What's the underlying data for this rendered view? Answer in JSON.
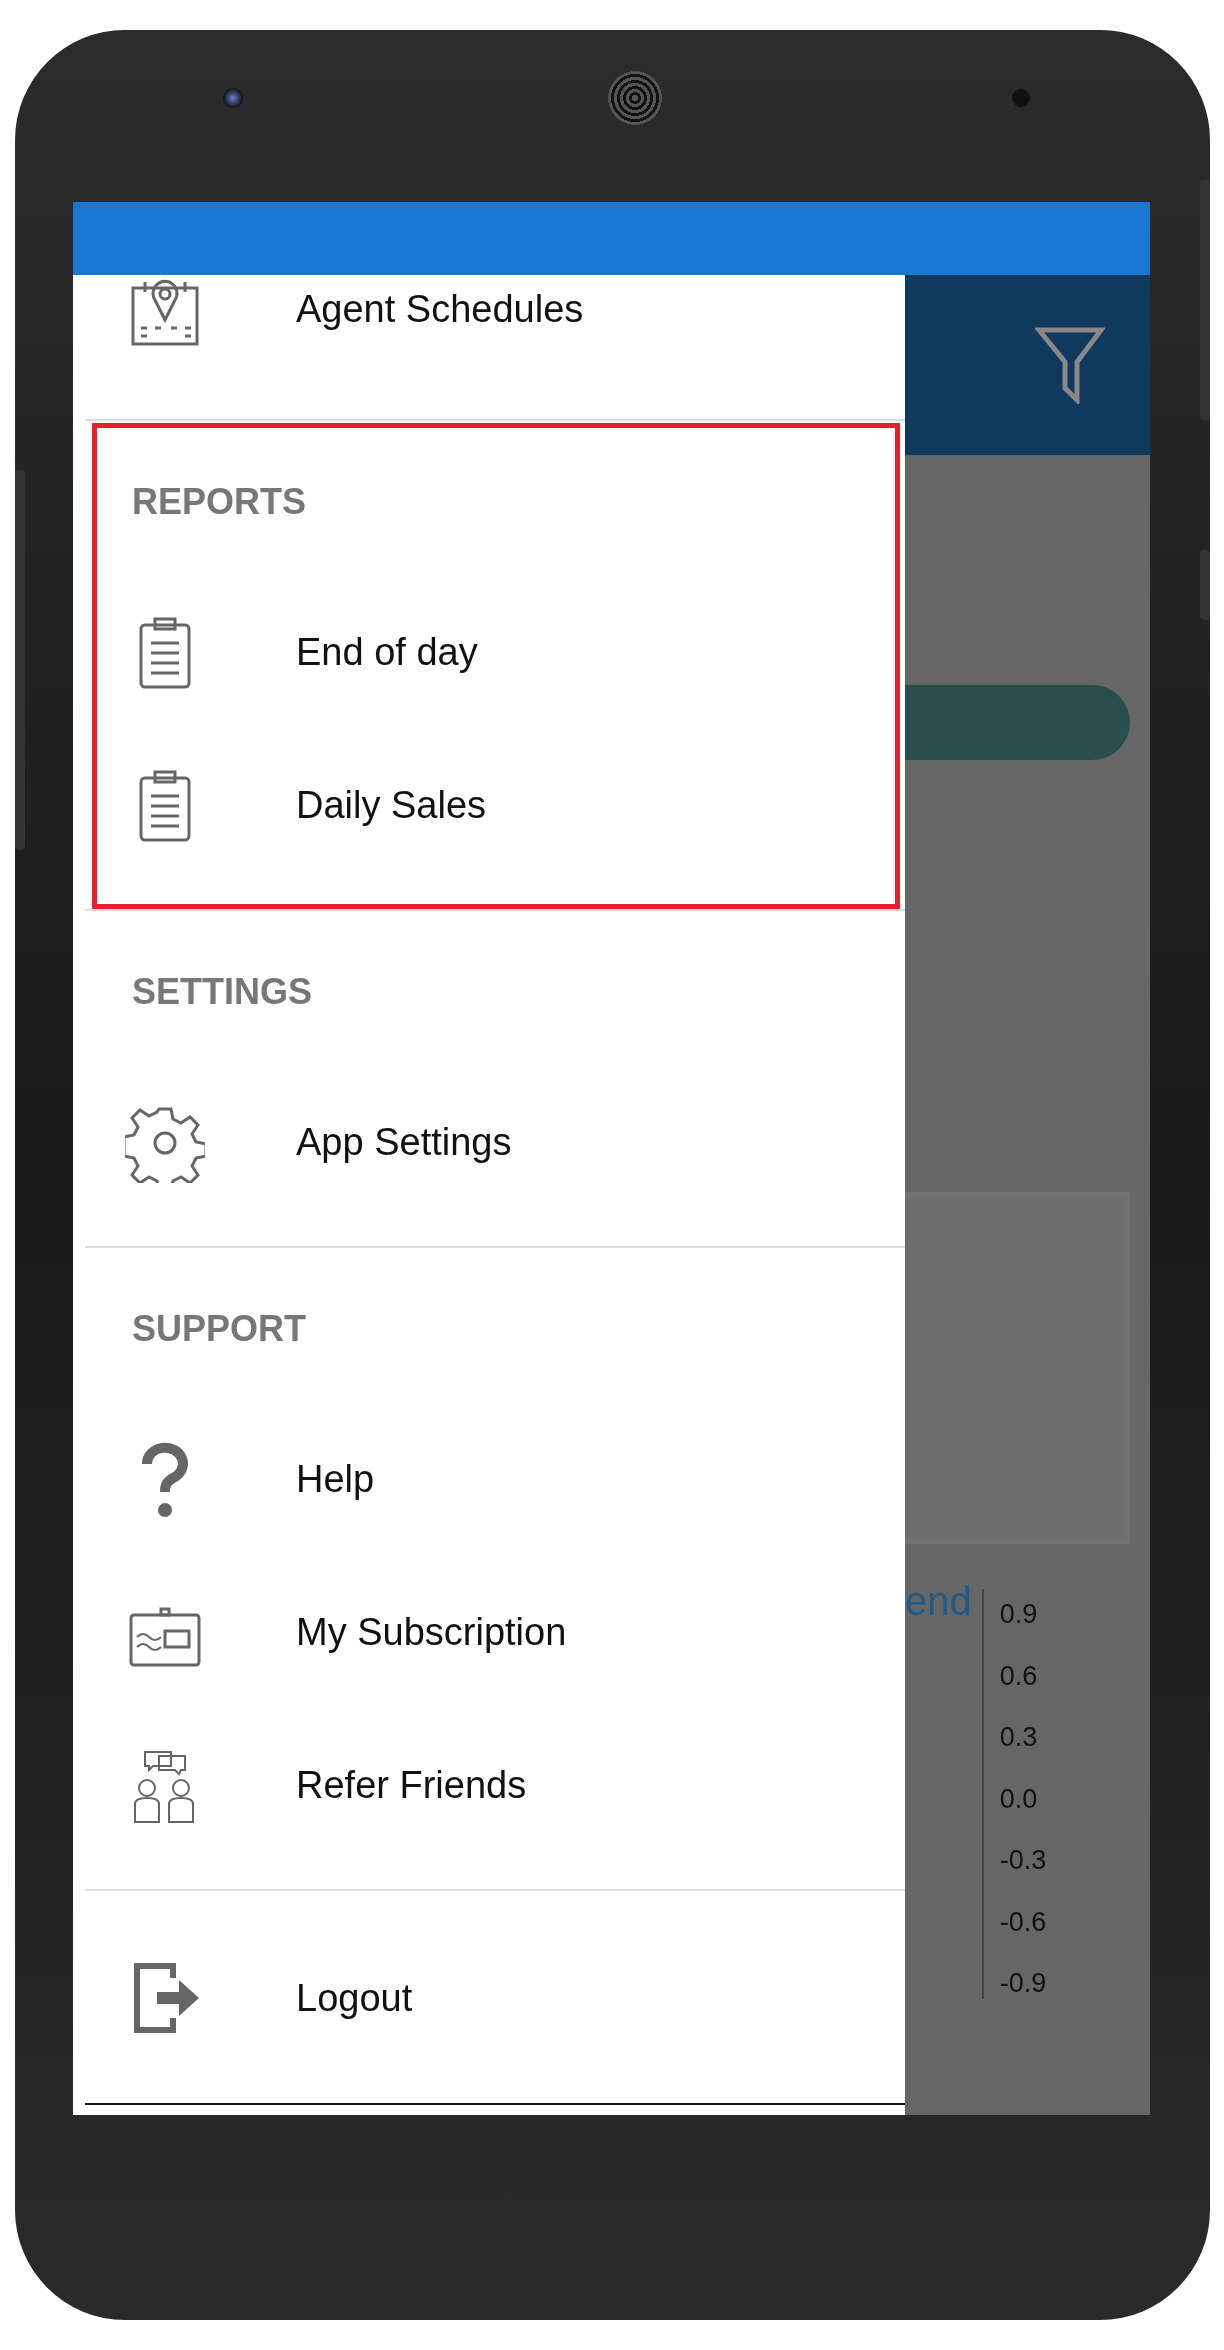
{
  "drawer": {
    "sections": [
      {
        "highlighted": false,
        "items": [
          {
            "label": "Agent Schedules",
            "kind": "schedule"
          }
        ]
      },
      {
        "heading": "REPORTS",
        "highlighted": true,
        "items": [
          {
            "label": "End of day",
            "kind": "report"
          },
          {
            "label": "Daily Sales",
            "kind": "report"
          }
        ]
      },
      {
        "heading": "SETTINGS",
        "highlighted": false,
        "items": [
          {
            "label": "App Settings",
            "kind": "settings"
          }
        ]
      },
      {
        "heading": "SUPPORT",
        "highlighted": false,
        "items": [
          {
            "label": "Help",
            "kind": "help"
          },
          {
            "label": "My Subscription",
            "kind": "subscription"
          },
          {
            "label": "Refer Friends",
            "kind": "referral"
          }
        ]
      },
      {
        "highlighted": false,
        "items": [
          {
            "label": "Logout",
            "kind": "logout"
          }
        ]
      }
    ]
  },
  "background_screen": {
    "legend_text": "end",
    "axis_labels": [
      "0.9",
      "0.6",
      "0.3",
      "0.0",
      "-0.3",
      "-0.6",
      "-0.9"
    ]
  }
}
